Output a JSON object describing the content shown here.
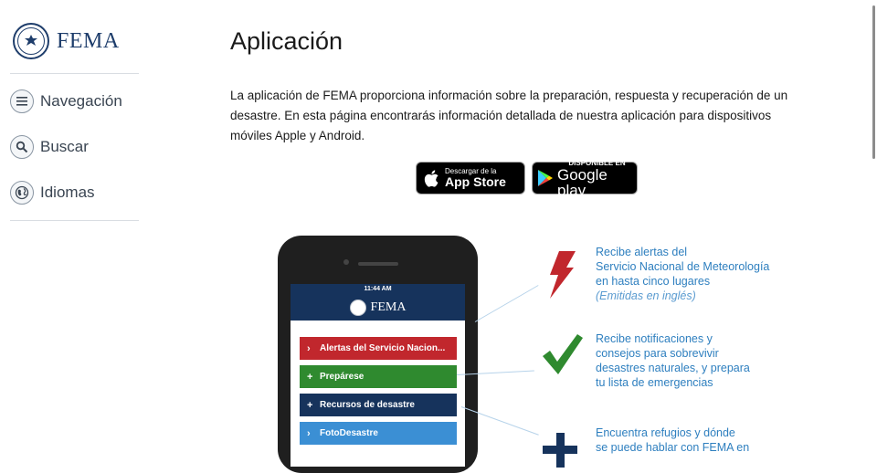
{
  "sidebar": {
    "logo_text": "FEMA",
    "items": [
      {
        "label": "Navegación",
        "icon": "menu-icon"
      },
      {
        "label": "Buscar",
        "icon": "search-icon"
      },
      {
        "label": "Idiomas",
        "icon": "globe-icon"
      }
    ]
  },
  "main": {
    "title": "Aplicación",
    "intro": "La aplicación de FEMA proporciona información sobre la preparación, respuesta y recuperación de un desastre. En esta página encontrarás información detallada de nuestra aplicación para dispositivos móviles Apple y Android.",
    "app_store": {
      "small": "Descargar de la",
      "big": "App Store"
    },
    "google_play": {
      "small": "DISPONIBLE EN",
      "big": "Google play"
    }
  },
  "phone": {
    "time": "11:44 AM",
    "header": "FEMA",
    "menu": [
      {
        "label": "Alertas del Servicio Nacion...",
        "glyph": "›",
        "color": "#c1272d"
      },
      {
        "label": "Prepárese",
        "glyph": "+",
        "color": "#2f8a2f"
      },
      {
        "label": "Recursos de desastre",
        "glyph": "+",
        "color": "#16335c"
      },
      {
        "label": "FotoDesastre",
        "glyph": "›",
        "color": "#3b8fd4"
      }
    ]
  },
  "features": [
    {
      "line1": "Recibe alertas del",
      "line2": "Servicio Nacional de Meteorología",
      "line3": "en hasta cinco lugares",
      "note": "(Emitidas en inglés)",
      "icon": "lightning-icon"
    },
    {
      "line1": "Recibe notificaciones y",
      "line2": "consejos para sobrevivir",
      "line3": "desastres naturales, y prepara",
      "line4": "tu lista de emergencias",
      "icon": "checkmark-icon"
    },
    {
      "line1": "Encuentra refugios y dónde",
      "line2": "se puede hablar con FEMA en",
      "icon": "plus-icon"
    }
  ],
  "colors": {
    "brand": "#1e3d6b",
    "accent_blue": "#2e7fbf",
    "alert_red": "#c1272d",
    "check_green": "#2f8a2f"
  }
}
